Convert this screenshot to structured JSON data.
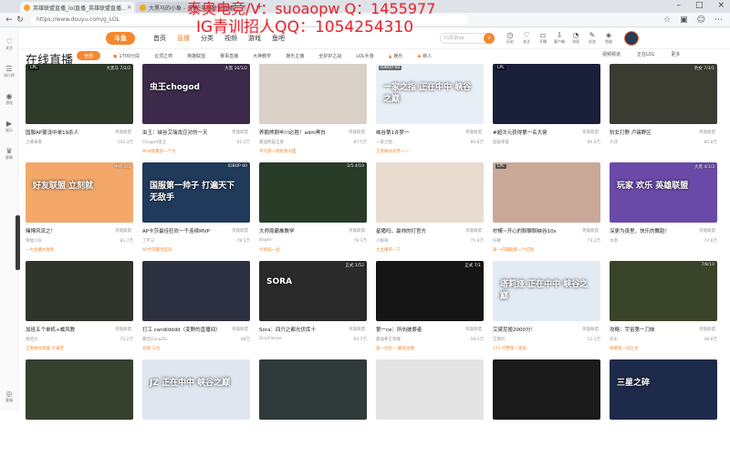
{
  "browser": {
    "tabs": [
      {
        "label": "英雄联盟直播_lol直播_英雄联盟直播..."
      },
      {
        "label": "大黑马的小象 - 斗鱼_英雄联盟直播..."
      }
    ],
    "url": "https://www.douyu.com/g_LOL"
  },
  "overlay": {
    "line1": "泰奥电竞/V：suoaopw  Q：1455977",
    "line2": "IG青训招人QQ：1054254310"
  },
  "sidebar": {
    "items": [
      {
        "label": "关注",
        "icon": "heart-icon"
      },
      {
        "label": "排行榜",
        "icon": "rank-icon"
      },
      {
        "label": "游戏",
        "icon": "game-icon"
      },
      {
        "label": "娱乐",
        "icon": "play-icon"
      },
      {
        "label": "赛事",
        "icon": "trophy-icon"
      }
    ],
    "bottom_label": "客服"
  },
  "header": {
    "logo": "斗鱼",
    "nav": [
      "首页",
      "直播",
      "分类",
      "视频",
      "游戏",
      "鱼吧"
    ],
    "active_nav": "直播",
    "search_placeholder": "IG青训qq",
    "icons": [
      {
        "label": "历史",
        "icon": "history-icon"
      },
      {
        "label": "关注",
        "icon": "follow-icon"
      },
      {
        "label": "开播",
        "icon": "live-icon"
      },
      {
        "label": "客户端",
        "icon": "download-icon"
      },
      {
        "label": "消息",
        "icon": "bell-icon"
      },
      {
        "label": "任务",
        "icon": "task-icon"
      },
      {
        "label": "鱼翅",
        "icon": "coin-icon"
      }
    ]
  },
  "page_title": "在线直播",
  "filters": {
    "all": "全部",
    "items": [
      "1700分段",
      "云顶之弈",
      "英雄联盟",
      "赛事直播",
      "大神教学",
      "娱乐主播",
      "全护护之战",
      "LOL手游",
      "娱乐",
      "新人"
    ],
    "right": [
      "视频频道",
      "正在LOL",
      "更多"
    ]
  },
  "cards": [
    {
      "title": "国服AP蒙泷中单19杀人",
      "category": "英雄联盟",
      "streamer": "上哪来看",
      "viewers": "102.3万",
      "tag": "",
      "badge_l": "LPL",
      "badge_r": "大黑马 7/2/2",
      "bg": "#2e3a2a",
      "big": ""
    },
    {
      "title": "虫王：峡谷艾瑞肯应对的一天",
      "category": "英雄联盟",
      "streamer": "Chogod虫王",
      "viewers": "91.2万",
      "tag": "Wild鬼雾争一个大",
      "badge_l": "",
      "badge_r": "大黑 10/1/2",
      "bg": "#3b2a4a",
      "big": "虫王chogod"
    },
    {
      "title": "养鹅熊刚毕川必胜！adm黑白",
      "category": "英雄联盟",
      "streamer": "最强熊猫王者",
      "viewers": "87.5万",
      "tag": "平凡搞一搞抗男对面",
      "badge_l": "",
      "badge_r": "",
      "bg": "#d9d0c8",
      "big": ""
    },
    {
      "title": "峡谷第1许梦一",
      "category": "英雄联盟",
      "streamer": "一家之指",
      "viewers": "80.8万",
      "tag": "王者峡谷许梦一一",
      "badge_l": "IDBOP 60",
      "badge_r": "",
      "bg": "#e8eef6",
      "big": "一家之指 正在中中 峡谷之巅"
    },
    {
      "title": "#超次元获得第一名大佬",
      "category": "英雄联盟",
      "streamer": "超级荣誉",
      "viewers": "89.6万",
      "tag": "",
      "badge_l": "LPL",
      "badge_r": "",
      "bg": "#1a1f3a",
      "big": ""
    },
    {
      "title": "豹女打野 卢锡野区",
      "category": "英雄联盟",
      "streamer": "大叔",
      "viewers": "80.8万",
      "tag": "",
      "badge_l": "",
      "badge_r": "豹女 7/3/1",
      "bg": "#3a3c32",
      "big": ""
    },
    {
      "title": "赌博风流之！",
      "category": "英雄联盟",
      "streamer": "笨拙小队",
      "viewers": "81.7万",
      "tag": "一大主播大胜利",
      "badge_l": "",
      "badge_r": "中单 3/3",
      "bg": "#f3a86a",
      "big": "好友联盟 立刻就"
    },
    {
      "title": "AP卡莎最佳狂欢一千连续MVP",
      "category": "英雄联盟",
      "streamer": "丁不三",
      "viewers": "78.5万",
      "tag": "AP卡莎最佳狂欢",
      "badge_l": "",
      "badge_r": "IDBOP 60",
      "bg": "#203a5c",
      "big": "国服第一帅子 打遍天下无敌手"
    },
    {
      "title": "大师局霸推教学",
      "category": "英雄联盟",
      "streamer": "Baghrr",
      "viewers": "78.3万",
      "tag": "大师局一战",
      "badge_l": "",
      "badge_r": "2/5 4/10",
      "bg": "#283c28",
      "big": ""
    },
    {
      "title": "星猪吗，最帅的打官方",
      "category": "英雄联盟",
      "streamer": "小狼哥",
      "viewers": "75.9万",
      "tag": "大主播带一下",
      "badge_l": "",
      "badge_r": "",
      "bg": "#e8dcd0",
      "big": ""
    },
    {
      "title": "柠檬~开心的聊聊聊峡谷10s",
      "category": "英雄联盟",
      "streamer": "柠檬",
      "viewers": "73.2万",
      "tag": "第一打辅助第一个打到",
      "badge_l": "LPL",
      "badge_r": "",
      "bg": "#c9a898",
      "big": ""
    },
    {
      "title": "深更为夜里，快乐的舞蹈！",
      "category": "英雄联盟",
      "streamer": "水草",
      "viewers": "74.8万",
      "tag": "",
      "badge_l": "",
      "badge_r": "大黑 4/1/3",
      "bg": "#6a4aa8",
      "big": "玩家 欢乐 英雄联盟"
    },
    {
      "title": "加班五个单机+威风教",
      "category": "英雄联盟",
      "streamer": "哈哈大",
      "viewers": "72.2万",
      "tag": "王者峡谷英雄 大满贯",
      "badge_l": "",
      "badge_r": "",
      "bg": "#30352c",
      "big": ""
    },
    {
      "title": "打工 candidddd（变野的直播间）",
      "category": "英雄联盟",
      "streamer": "最佳ZanaZhi",
      "viewers": "68万",
      "tag": "召唤 三台",
      "badge_l": "",
      "badge_r": "",
      "bg": "#2c3040",
      "big": ""
    },
    {
      "title": "Sora：四只之都光伏库十",
      "category": "英雄联盟",
      "streamer": "ZinoFlanea",
      "viewers": "64.7万",
      "tag": "",
      "badge_l": "",
      "badge_r": "正式 1/52",
      "bg": "#2a2a2a",
      "big": "SORA"
    },
    {
      "title": "第一ce：所向披靡者",
      "category": "英雄联盟",
      "streamer": "最强拳王荣耀",
      "viewers": "58.1万",
      "tag": "第一剑主一 最强主播",
      "badge_l": "",
      "badge_r": "正式 7/1",
      "bg": "#151515",
      "big": ""
    },
    {
      "title": "艾黛尼娅2000分！",
      "category": "英雄联盟",
      "streamer": "艾黛尼",
      "viewers": "52.1万",
      "tag": "171 打野第一游击",
      "badge_l": "",
      "badge_r": "",
      "bg": "#e2eaf4",
      "big": "塔莉娅 正在中中 峡谷之巅"
    },
    {
      "title": "攻略：宇宙第一刀妹",
      "category": "英雄联盟",
      "streamer": "欢乐",
      "viewers": "48.8万",
      "tag": "攻略第一剑之主",
      "badge_l": "",
      "badge_r": "7/8/10",
      "bg": "#3a4428",
      "big": ""
    },
    {
      "title": "",
      "category": "",
      "streamer": "",
      "viewers": "",
      "tag": "",
      "badge_l": "",
      "badge_r": "",
      "bg": "#36402f",
      "big": ""
    },
    {
      "title": "",
      "category": "",
      "streamer": "",
      "viewers": "",
      "tag": "",
      "badge_l": "",
      "badge_r": "",
      "bg": "#dfe6ef",
      "big": "JZ 正在中中 峡谷之巅"
    },
    {
      "title": "",
      "category": "",
      "streamer": "",
      "viewers": "",
      "tag": "",
      "badge_l": "",
      "badge_r": "",
      "bg": "#2f3a3a",
      "big": ""
    },
    {
      "title": "",
      "category": "",
      "streamer": "",
      "viewers": "",
      "tag": "",
      "badge_l": "",
      "badge_r": "",
      "bg": "#e4e4e4",
      "big": ""
    },
    {
      "title": "",
      "category": "",
      "streamer": "",
      "viewers": "",
      "tag": "",
      "badge_l": "",
      "badge_r": "",
      "bg": "#1a1a1a",
      "big": ""
    },
    {
      "title": "",
      "category": "",
      "streamer": "",
      "viewers": "",
      "tag": "",
      "badge_l": "",
      "badge_r": "",
      "bg": "#1e2a4a",
      "big": "三星之碎"
    }
  ]
}
